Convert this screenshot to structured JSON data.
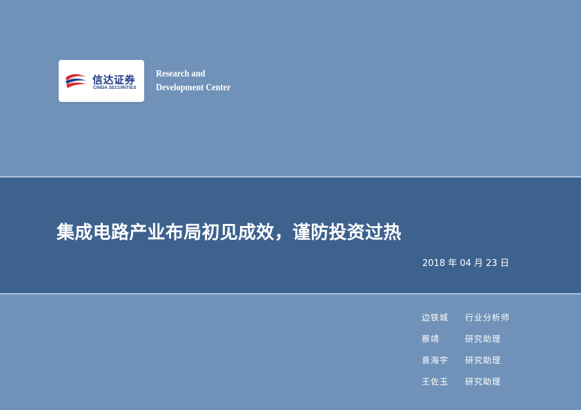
{
  "brand": {
    "name_cn": "信达证券",
    "name_en": "CINDA SECURITIES",
    "center_line1": "Research and",
    "center_line2": "Development Center",
    "colors": {
      "swoosh_red": "#d7282f",
      "swoosh_blue": "#1f3f86",
      "brand_text": "#1f3f86"
    }
  },
  "report": {
    "title": "集成电路产业布局初见成效，谨防投资过热",
    "date": "2018 年 04 月 23 日"
  },
  "authors": [
    {
      "name": "边铁城",
      "role": "行业分析师"
    },
    {
      "name": "蔡靖",
      "role": "研究助理"
    },
    {
      "name": "袁海宇",
      "role": "研究助理"
    },
    {
      "name": "王佐玉",
      "role": "研究助理"
    }
  ],
  "theme": {
    "background": "#7092b8",
    "band": "#3e628e",
    "text": "#ffffff"
  }
}
